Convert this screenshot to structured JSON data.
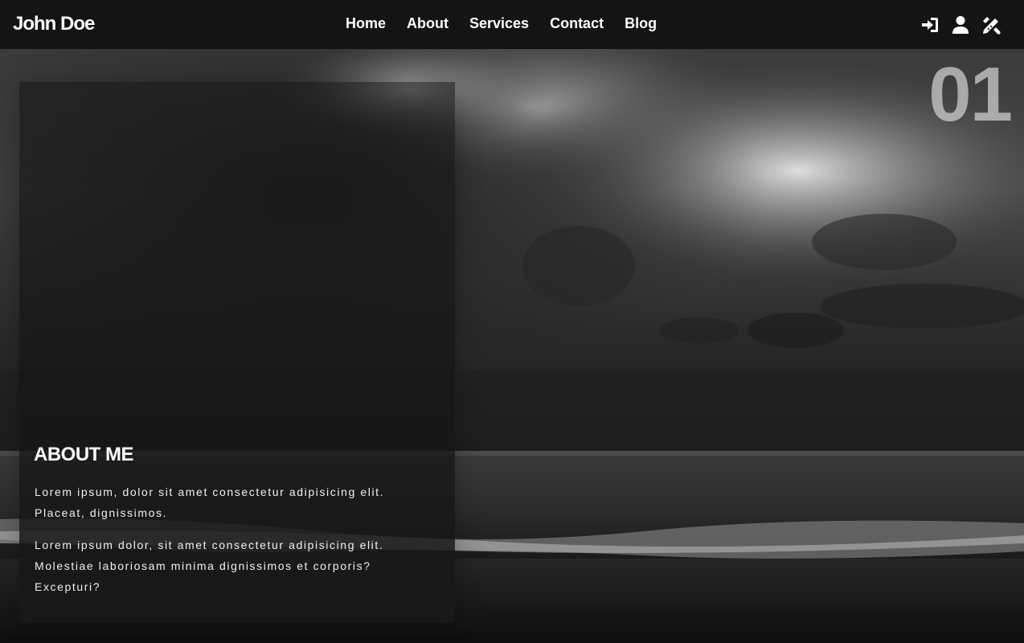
{
  "navbar": {
    "brand": "John Doe",
    "links": [
      {
        "label": "Home"
      },
      {
        "label": "About"
      },
      {
        "label": "Services"
      },
      {
        "label": "Contact"
      },
      {
        "label": "Blog"
      }
    ],
    "icons": [
      "sign-in-icon",
      "user-icon",
      "tools-icon"
    ]
  },
  "hero": {
    "slide_number": "01"
  },
  "about": {
    "title": "ABOUT ME",
    "paragraphs": [
      "Lorem ipsum, dolor sit amet consectetur adipisicing elit. Placeat, dignissimos.",
      "Lorem ipsum dolor, sit amet consectetur adipisicing elit. Molestiae laboriosam minima dignissimos et corporis? Excepturi?"
    ]
  },
  "colors": {
    "navbar_bg": "#141414",
    "text": "#ffffff"
  }
}
